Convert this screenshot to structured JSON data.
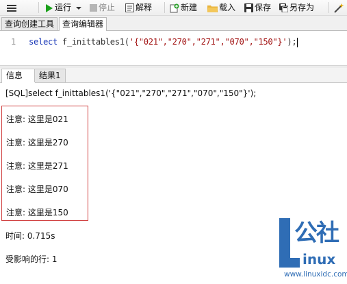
{
  "toolbar": {
    "run_label": "运行",
    "stop_label": "停止",
    "explain_label": "解释",
    "new_label": "新建",
    "load_label": "载入",
    "save_label": "保存",
    "save_as_label": "另存为"
  },
  "editor_tabs": [
    {
      "label": "查询创建工具",
      "active": false
    },
    {
      "label": "查询编辑器",
      "active": true
    }
  ],
  "editor": {
    "line_number": "1",
    "keyword": "select",
    "function": " f_inittables1(",
    "string_arg": "'{\"021\",\"270\",\"271\",\"070\",\"150\"}'",
    "tail": ");"
  },
  "result_tabs": [
    {
      "label": "信息",
      "active": true
    },
    {
      "label": "结果1",
      "active": false
    }
  ],
  "messages": {
    "sql_echo": "[SQL]select f_inittables1('{\"021\",\"270\",\"271\",\"070\",\"150\"}');",
    "notices": [
      "注意:  这里是021",
      "注意:  这里是270",
      "注意:  这里是271",
      "注意:  这里是070",
      "注意:  这里是150"
    ],
    "time": "时间: 0.715s",
    "affected_rows": "受影响的行: 1"
  },
  "watermark": {
    "brand_text": "公社",
    "linux_text": "inux",
    "url": "www.linuxidc.com"
  },
  "colors": {
    "keyword": "#1b39b8",
    "string": "#a31515",
    "notice_border": "#d04040",
    "watermark_blue": "#2f6db5"
  }
}
